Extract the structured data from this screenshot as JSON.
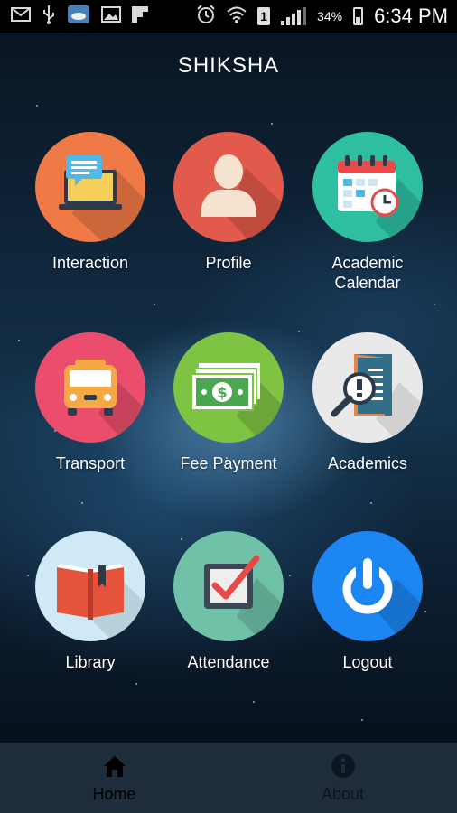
{
  "status_bar": {
    "time": "6:34 PM",
    "battery_percent": "34%",
    "sim_slot": "1",
    "icons": [
      "mail-icon",
      "usb-icon",
      "weather-icon",
      "image-icon",
      "flipboard-icon",
      "alarm-icon",
      "wifi-icon",
      "sim-icon",
      "signal-icon",
      "battery-icon"
    ]
  },
  "header": {
    "title": "SHIKSHA"
  },
  "menu": {
    "interaction": {
      "label": "Interaction",
      "color": "#ef7a45"
    },
    "profile": {
      "label": "Profile",
      "color": "#e25a4c"
    },
    "academic_calendar": {
      "label": "Academic Calendar",
      "color": "#2dbfa0"
    },
    "transport": {
      "label": "Transport",
      "color": "#ea4e6c"
    },
    "fee_payment": {
      "label": "Fee Payment",
      "color": "#7fc342"
    },
    "academics": {
      "label": "Academics",
      "color": "#e9e9e9"
    },
    "library": {
      "label": "Library",
      "color": "#cfe9f6"
    },
    "attendance": {
      "label": "Attendance",
      "color": "#6fc2a8"
    },
    "logout": {
      "label": "Logout",
      "color": "#1c86f2"
    }
  },
  "bottom_nav": {
    "home": {
      "label": "Home",
      "icon": "home-icon",
      "active": true
    },
    "about": {
      "label": "About",
      "icon": "info-icon",
      "active": false
    }
  }
}
